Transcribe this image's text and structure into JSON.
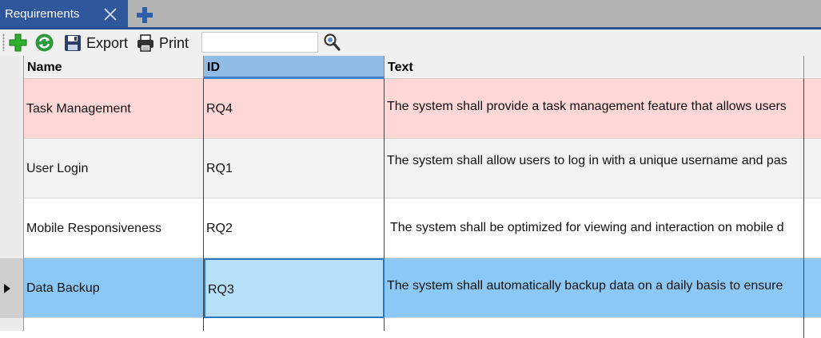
{
  "tabs": [
    {
      "label": "Requirements",
      "active": true
    }
  ],
  "toolbar": {
    "export_label": "Export",
    "print_label": "Print",
    "search_value": "",
    "search_placeholder": ""
  },
  "grid": {
    "columns": [
      "Name",
      "ID",
      "Text"
    ],
    "rows": [
      {
        "name": "Task Management",
        "id": "RQ4",
        "text": "The system shall provide a task management feature that allows users"
      },
      {
        "name": "User Login",
        "id": "RQ1",
        "text": "The system shall allow users to log in with a unique username and pas"
      },
      {
        "name": "Mobile Responsiveness",
        "id": "RQ2",
        "text": "The system shall be optimized for viewing and interaction on mobile d"
      },
      {
        "name": "Data Backup",
        "id": "RQ3",
        "text": "The system shall automatically backup data on a daily basis to ensure"
      }
    ],
    "selected_row": 4
  },
  "colors": {
    "tab_active": "#2f579b",
    "row_highlight": "#ffd7d7",
    "row_selected": "#8cc8f5",
    "selected_cell": "#b7e0fa",
    "sorted_column_header": "#8fbde6"
  },
  "icons": {
    "tab_close": "close-icon",
    "tab_add": "plus-icon",
    "add": "add-icon",
    "refresh": "refresh-icon",
    "export": "save-icon",
    "print": "printer-icon",
    "search": "search-icon"
  }
}
